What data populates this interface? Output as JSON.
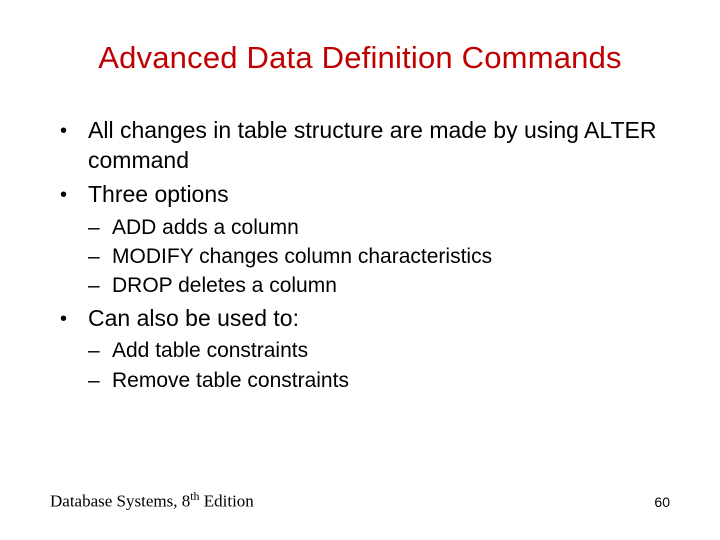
{
  "title": "Advanced Data Definition Commands",
  "bullets": {
    "b1": "All changes in table structure are made by using ALTER command",
    "b2": "Three options",
    "b2_sub": {
      "s1": "ADD adds a column",
      "s2": "MODIFY changes column characteristics",
      "s3": "DROP deletes a column"
    },
    "b3": "Can also be used to:",
    "b3_sub": {
      "s1": "Add table constraints",
      "s2": "Remove table constraints"
    }
  },
  "footer": {
    "left_pre": "Database Systems, 8",
    "left_sup": "th",
    "left_post": " Edition",
    "page": "60"
  }
}
